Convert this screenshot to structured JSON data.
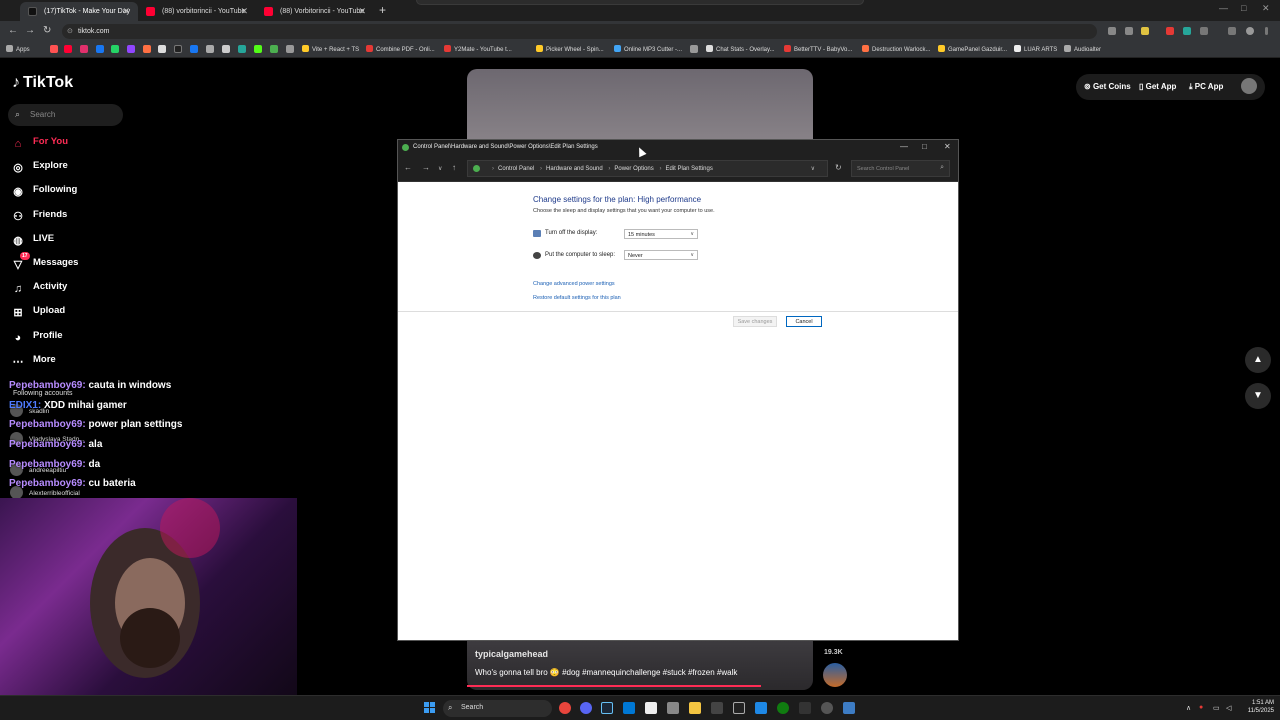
{
  "browser": {
    "tabs": [
      {
        "title": "(17)TikTok - Make Your Day",
        "color": "#111111"
      },
      {
        "title": "(88) vorbitorincii - YouTube",
        "color": "#ff0033"
      },
      {
        "title": "(88) Vorbitorincii - YouTube",
        "color": "#ff0033"
      }
    ],
    "url": "tiktok.com",
    "bookmarks": [
      "Apps",
      "Vite + React + TS",
      "Combine PDF - Onli...",
      "Y2Mate - YouTube t...",
      "Picker Wheel - Spin...",
      "Online MP3 Cutter -...",
      "Chat Stats - Overlay...",
      "BetterTTV - BabyVo...",
      "Destruction Warlock...",
      "GamePanel Gazduir...",
      "LUAR ARTS",
      "Audioalter"
    ]
  },
  "tiktok": {
    "logo": "TikTok",
    "search_placeholder": "Search",
    "nav": [
      {
        "label": "For You",
        "icon": "home-icon",
        "active": true
      },
      {
        "label": "Explore",
        "icon": "compass-icon"
      },
      {
        "label": "Following",
        "icon": "following-icon"
      },
      {
        "label": "Friends",
        "icon": "friends-icon"
      },
      {
        "label": "LIVE",
        "icon": "live-icon"
      },
      {
        "label": "Messages",
        "icon": "message-icon",
        "badge": "17"
      },
      {
        "label": "Activity",
        "icon": "bell-icon"
      },
      {
        "label": "Upload",
        "icon": "upload-icon"
      },
      {
        "label": "Profile",
        "icon": "profile-icon"
      },
      {
        "label": "More",
        "icon": "more-icon"
      }
    ],
    "following_accounts_label": "Following accounts",
    "following_accounts": [
      "skadlin",
      "Vladyslava Stadn...",
      "andreeapiltiu",
      "Alexterribleofficial"
    ],
    "top_buttons": {
      "coins": "Get Coins",
      "app": "Get App",
      "pc": "PC App"
    },
    "video": {
      "username": "typicalgamehead",
      "caption": "Who's gonna tell bro 😳 #dog #mannequinchallenge #stuck #frozen #walk",
      "likes": "19.3K",
      "progress": 0.85
    }
  },
  "chat": [
    {
      "user": "Pepebamboy69:",
      "msg": "cauta in windows"
    },
    {
      "user": "EDIX1:",
      "msg": "XDD mihai gamer"
    },
    {
      "user": "Pepebamboy69:",
      "msg": "power plan settings"
    },
    {
      "user": "Pepebamboy69:",
      "msg": "ala"
    },
    {
      "user": "Pepebamboy69:",
      "msg": "da"
    },
    {
      "user": "Pepebamboy69:",
      "msg": "cu bateria"
    }
  ],
  "control_panel": {
    "title": "Control Panel\\Hardware and Sound\\Power Options\\Edit Plan Settings",
    "breadcrumb": [
      "Control Panel",
      "Hardware and Sound",
      "Power Options",
      "Edit Plan Settings"
    ],
    "search_placeholder": "Search Control Panel",
    "heading": "Change settings for the plan: High performance",
    "subheading": "Choose the sleep and display settings that you want your computer to use.",
    "display_label": "Turn off the display:",
    "display_value": "15 minutes",
    "sleep_label": "Put the computer to sleep:",
    "sleep_value": "Never",
    "advanced_link": "Change advanced power settings",
    "restore_link": "Restore default settings for this plan",
    "save_label": "Save changes",
    "cancel_label": "Cancel"
  },
  "taskbar": {
    "search_label": "Search",
    "time": "1:51 AM",
    "date": "11/5/2025"
  }
}
